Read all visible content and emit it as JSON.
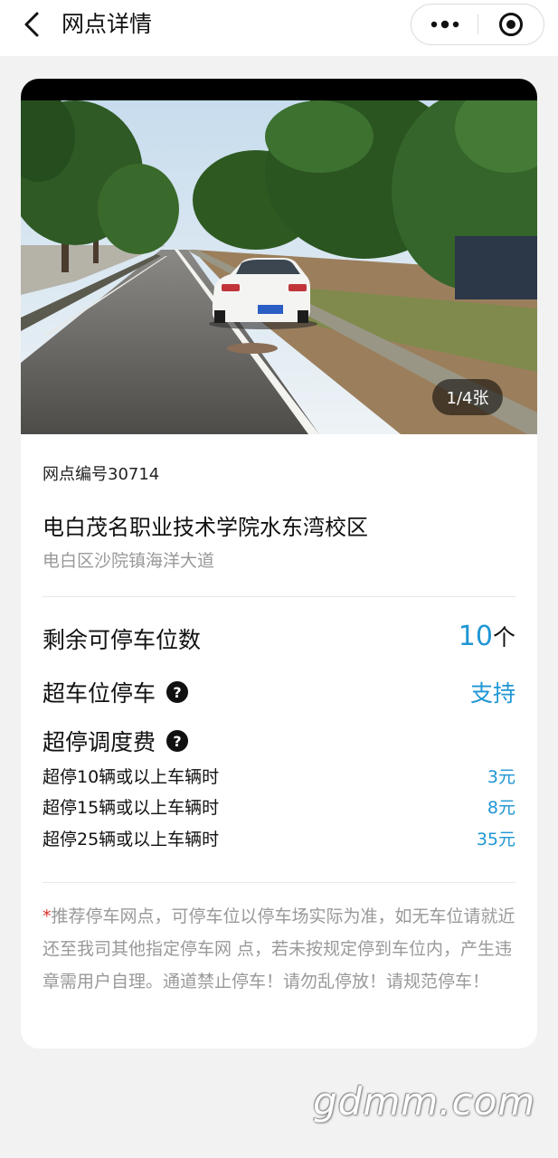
{
  "navbar": {
    "title": "网点详情",
    "back_icon": "chevron-left-icon",
    "more_icon": "more-dots-icon",
    "close_icon": "target-circle-icon"
  },
  "gallery": {
    "counter": "1/4张"
  },
  "site": {
    "code": "网点编号30714",
    "name": "电白茂名职业技术学院水东湾校区",
    "address": "电白区沙院镇海洋大道"
  },
  "parking": {
    "spaces_label": "剩余可停车位数",
    "spaces_count": "10",
    "spaces_unit": "个",
    "overflow_label": "超车位停车",
    "overflow_value": "支持"
  },
  "fees": {
    "label": "超停调度费",
    "items": [
      {
        "condition": "超停10辆或以上车辆时",
        "price": "3元"
      },
      {
        "condition": "超停15辆或以上车辆时",
        "price": "8元"
      },
      {
        "condition": "超停25辆或以上车辆时",
        "price": "35元"
      }
    ]
  },
  "notice": {
    "star": "*",
    "text": "推荐停车网点，可停车位以停车场实际为准，如无车位请就近还至我司其他指定停车网 点，若未按规定停到车位内，产生违章需用户自理。通道禁止停车！请勿乱停放！请规范停车！"
  },
  "watermark": "gdmm.com",
  "colors": {
    "accent": "#1f96d4",
    "required_star": "#d9302b",
    "muted_text": "#999999",
    "background": "#f2f2f2"
  }
}
